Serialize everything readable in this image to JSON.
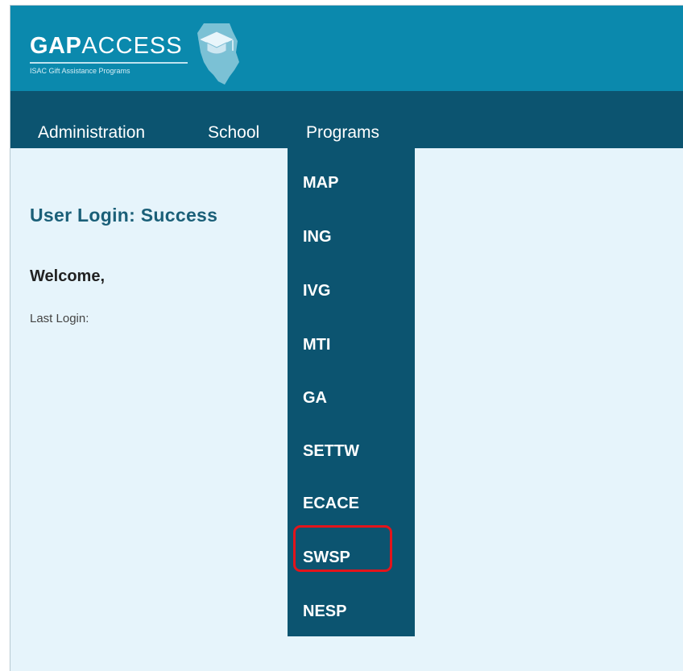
{
  "logo": {
    "brand_bold": "GAP",
    "brand_light": "ACCESS",
    "tagline": "ISAC Gift Assistance Programs",
    "icon": "illinois-graduation-cap-icon"
  },
  "nav": {
    "items": [
      {
        "label": "Administration"
      },
      {
        "label": "School"
      },
      {
        "label": "Programs"
      }
    ]
  },
  "content": {
    "title": "User Login: Success",
    "welcome": "Welcome,",
    "last_login_label": "Last Login:"
  },
  "programs_menu": {
    "items": [
      {
        "label": "MAP"
      },
      {
        "label": "ING"
      },
      {
        "label": "IVG"
      },
      {
        "label": "MTI"
      },
      {
        "label": "GA"
      },
      {
        "label": "SETTW"
      },
      {
        "label": "ECACE"
      },
      {
        "label": "SWSP",
        "highlighted": true
      },
      {
        "label": "NESP"
      }
    ]
  },
  "colors": {
    "banner": "#0b89ad",
    "navbar": "#0c5470",
    "page_background": "#e6f4fb",
    "title_text": "#1a5f78",
    "highlight": "#e3141b"
  }
}
